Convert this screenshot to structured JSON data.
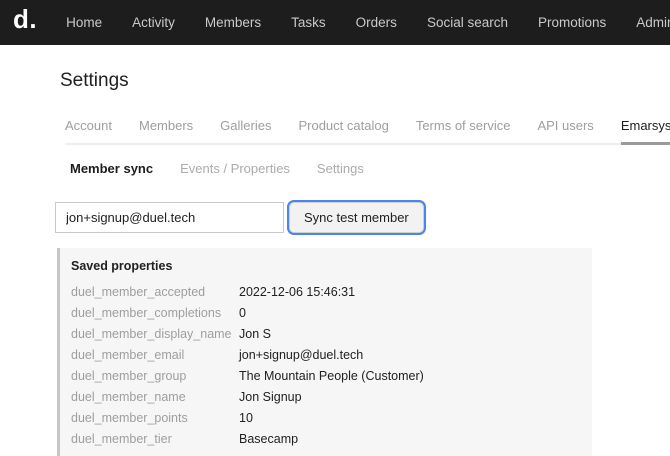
{
  "nav": {
    "logo": "d.",
    "items": [
      {
        "label": "Home"
      },
      {
        "label": "Activity"
      },
      {
        "label": "Members"
      },
      {
        "label": "Tasks"
      },
      {
        "label": "Orders"
      },
      {
        "label": "Social search"
      },
      {
        "label": "Promotions"
      },
      {
        "label": "Admin"
      }
    ]
  },
  "page": {
    "title": "Settings"
  },
  "tabs": {
    "items": [
      {
        "label": "Account",
        "active": false
      },
      {
        "label": "Members",
        "active": false
      },
      {
        "label": "Galleries",
        "active": false
      },
      {
        "label": "Product catalog",
        "active": false
      },
      {
        "label": "Terms of service",
        "active": false
      },
      {
        "label": "API users",
        "active": false
      },
      {
        "label": "Emarsys",
        "active": true
      }
    ]
  },
  "subtabs": {
    "items": [
      {
        "label": "Member sync",
        "active": true
      },
      {
        "label": "Events / Properties",
        "active": false
      },
      {
        "label": "Settings",
        "active": false
      }
    ]
  },
  "form": {
    "email_value": "jon+signup@duel.tech",
    "sync_button_label": "Sync test member"
  },
  "saved_properties": {
    "title": "Saved properties",
    "rows": [
      {
        "key": "duel_member_accepted",
        "value": "2022-12-06 15:46:31"
      },
      {
        "key": "duel_member_completions",
        "value": "0"
      },
      {
        "key": "duel_member_display_name",
        "value": "Jon S"
      },
      {
        "key": "duel_member_email",
        "value": "jon+signup@duel.tech"
      },
      {
        "key": "duel_member_group",
        "value": "The Mountain People (Customer)"
      },
      {
        "key": "duel_member_name",
        "value": "Jon Signup"
      },
      {
        "key": "duel_member_points",
        "value": "10"
      },
      {
        "key": "duel_member_tier",
        "value": "Basecamp"
      }
    ]
  },
  "colors": {
    "navbar_bg": "#1d1d1d",
    "nav_text": "#c9c9c9",
    "accent_focus_ring": "#4b83ef",
    "active_tab_underline": "#9b9b9b",
    "panel_bg": "#f6f6f6",
    "panel_border": "#c6c6c6",
    "muted_text": "#9e9e9e"
  }
}
